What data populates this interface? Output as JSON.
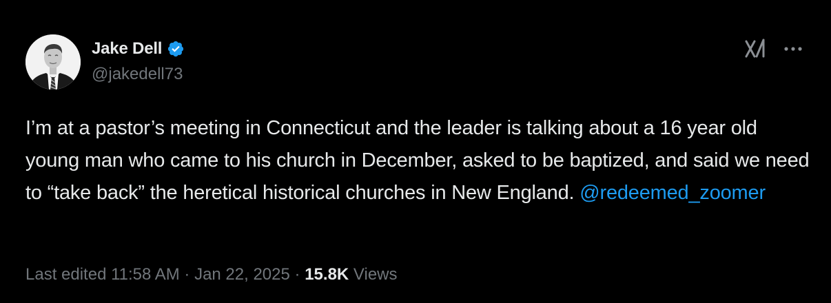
{
  "author": {
    "display_name": "Jake Dell",
    "handle": "@jakedell73",
    "verified": true,
    "avatar_icon": "person-photo",
    "verified_icon": "verified-badge-icon",
    "verified_color": "#1d9bf0"
  },
  "header_actions": {
    "grok_icon": "grok-icon",
    "more_icon": "more-dots-icon"
  },
  "tweet": {
    "text": "I’m at a pastor’s meeting in Connecticut and the leader is talking about a 16 year old young man who came to his church in December, asked to be baptized, and said we need to “take back” the heretical historical churches in New England. ",
    "mention": "@redeemed_zoomer"
  },
  "meta": {
    "edited_label": "Last edited",
    "time": "11:58 AM",
    "separator": "·",
    "date": "Jan 22, 2025",
    "views_count": "15.8K",
    "views_label": "Views"
  },
  "colors": {
    "background": "#000000",
    "text_primary": "#e7e9ea",
    "text_secondary": "#71767b",
    "link": "#1d9bf0"
  }
}
